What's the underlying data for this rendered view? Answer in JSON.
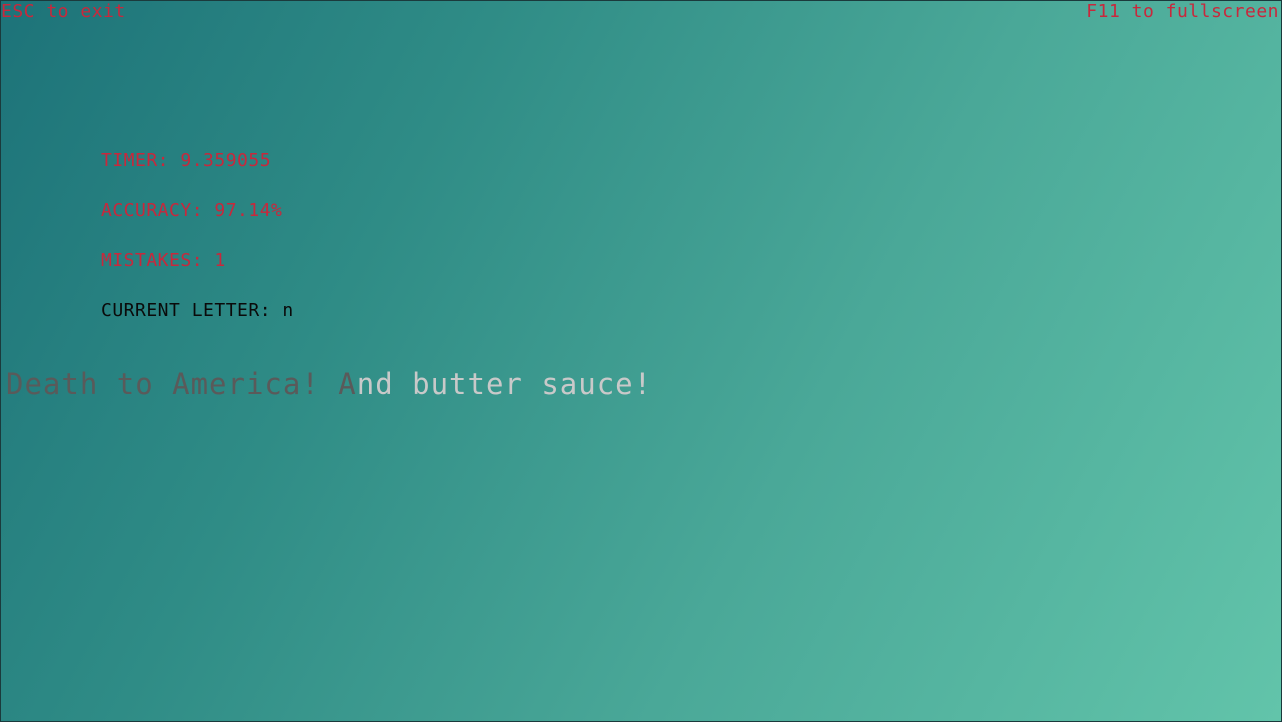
{
  "hints": {
    "exit": "ESC to exit",
    "fullscreen": "F11 to fullscreen"
  },
  "stats": {
    "timer": "TIMER: 9.359055",
    "accuracy": "ACCURACY: 97.14%",
    "mistakes": "MISTAKES: 1",
    "current_letter": "CURRENT LETTER: n"
  },
  "sentence": {
    "typed": "Death to America! A",
    "remaining": "nd butter sauce!"
  },
  "colors": {
    "hint_text": "#c8283c",
    "stat_text": "#c8283c",
    "current_letter_text": "#0a0a0a",
    "typed_text": "#5a5a5a",
    "remaining_text": "#c9c9c9",
    "background_start": "#1d7379",
    "background_end": "#62c4aa"
  }
}
